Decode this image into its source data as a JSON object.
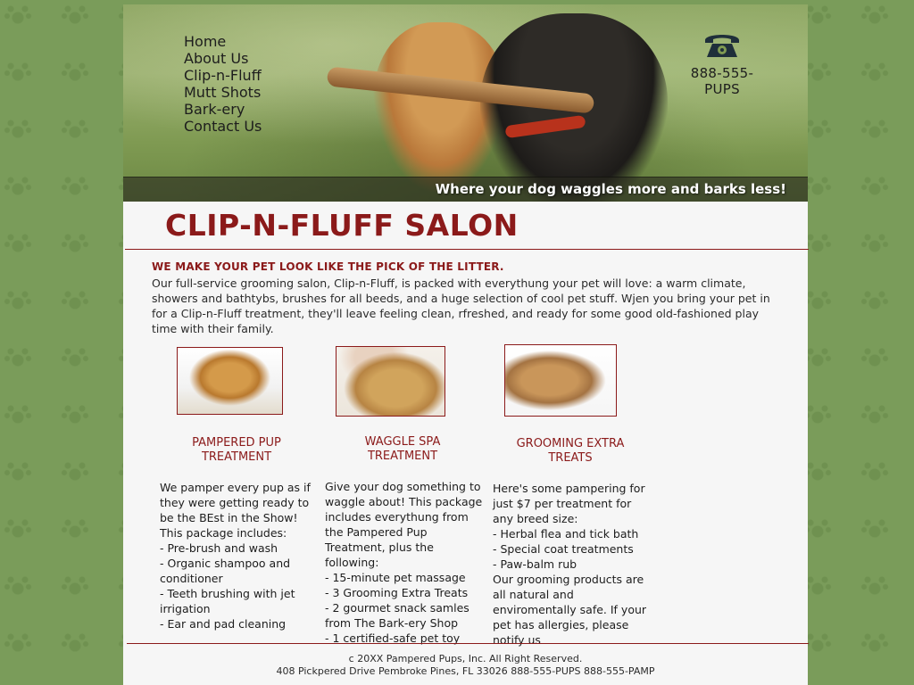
{
  "nav": {
    "items": [
      "Home",
      "About Us",
      "Clip-n-Fluff",
      "Mutt Shots",
      "Bark-ery",
      "Contact Us"
    ]
  },
  "header": {
    "phone": "888-555-PUPS",
    "phone_icon": "telephone-icon",
    "tagline": "Where your dog waggles more and barks less!"
  },
  "main": {
    "title": "CLIP-N-FLUFF SALON",
    "intro_heading": "WE MAKE YOUR PET LOOK LIKE THE PICK OF THE LITTER.",
    "intro_text": "Our full-service grooming salon, Clip-n-Fluff, is packed with everythung your pet will love: a warm climate, showers and bathtybs, brushes for all beeds, and a huge selection of cool pet stuff. Wjen you bring your pet in for a Clip-n-Fluff treatment, they'll leave feeling clean, rfreshed, and ready for some good old-fashioned play time with their family."
  },
  "treatments": [
    {
      "heading": "PAMPERED PUP TREATMENT",
      "text": "We pamper every pup as if they were getting ready to be the BEst in the Show! This package includes:\n- Pre-brush and wash\n- Organic shampoo and conditioner\n- Teeth brushing with jet irrigation\n- Ear and pad cleaning"
    },
    {
      "heading": "WAGGLE SPA TREATMENT",
      "text": "Give your dog something to waggle about! This package includes everythung from the Pampered Pup Treatment, plus the following:\n- 15-minute pet massage\n- 3 Grooming Extra Treats\n- 2 gourmet snack samles from The Bark-ery Shop\n- 1 certified-safe pet toy"
    },
    {
      "heading": "GROOMING EXTRA TREATS",
      "text": "Here's some pampering for just $7 per treatment for any breed size:\n- Herbal flea and tick bath\n- Special coat treatments\n- Paw-balm rub\nOur grooming products are all natural and enviromentally safe. If your pet has allergies, please notify us"
    }
  ],
  "footer": {
    "line1": "c 20XX Pampered Pups, Inc. All Right Reserved.",
    "line2": "408 Pickpered Drive Pembroke Pines, FL 33026 888-555-PUPS  888-555-PAMP"
  },
  "colors": {
    "accent": "#8b1a1a",
    "background": "#7a9c5a",
    "content_bg": "#f6f6f6"
  }
}
